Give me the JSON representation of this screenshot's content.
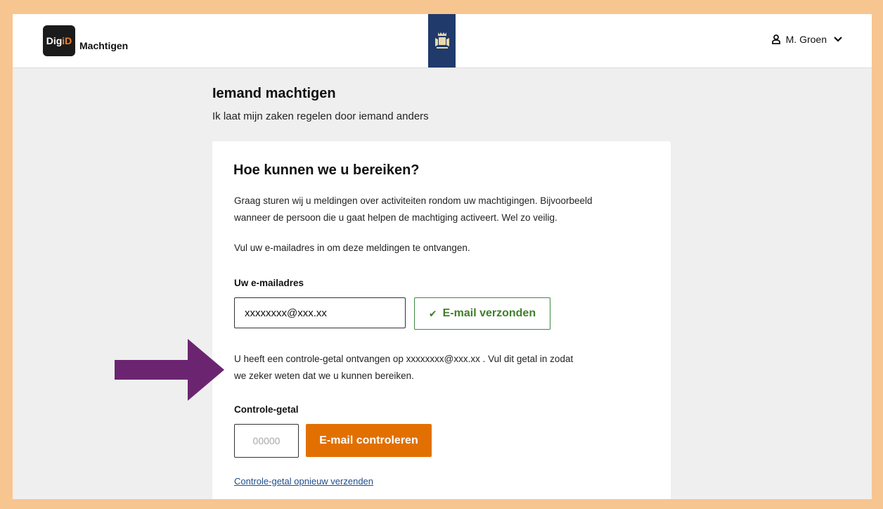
{
  "header": {
    "logo_text_prefix": "Dig",
    "logo_text_suffix": "iD",
    "brand_label": "Machtigen",
    "user_name": "M. Groen"
  },
  "page": {
    "title": "Iemand machtigen",
    "subtitle": "Ik laat mijn zaken regelen door iemand anders"
  },
  "card": {
    "heading": "Hoe kunnen we u bereiken?",
    "intro_line1": "Graag sturen wij u meldingen over activiteiten rondom uw machtigingen. Bijvoorbeeld",
    "intro_line2": "wanneer de persoon die u gaat helpen de machtiging activeert. Wel zo veilig.",
    "instruction": "Vul uw e-mailadres in om deze meldingen te ontvangen.",
    "email_label": "Uw e-mailadres",
    "email_value": "xxxxxxxx@xxx.xx",
    "sent_label": "E-mail verzonden",
    "confirmation_line1": "U heeft een controle-getal ontvangen op xxxxxxxx@xxx.xx . Vul dit getal in zodat",
    "confirmation_line2": "we zeker weten dat we u kunnen bereiken.",
    "code_label": "Controle-getal",
    "code_placeholder": "00000",
    "check_button": "E-mail controleren",
    "resend_link": "Controle-getal opnieuw verzenden"
  },
  "colors": {
    "frame_border": "#f7c58f",
    "background": "#efefef",
    "primary_orange": "#e17000",
    "success_green": "#3f7f2a",
    "rijksoverheid_blue": "#1f3a6b",
    "annotation_arrow": "#6b2570"
  },
  "icons": {
    "user": "user-icon",
    "chevron": "chevron-down-icon",
    "check": "check-icon",
    "crest": "crest-icon",
    "arrow": "arrow-right-icon"
  }
}
